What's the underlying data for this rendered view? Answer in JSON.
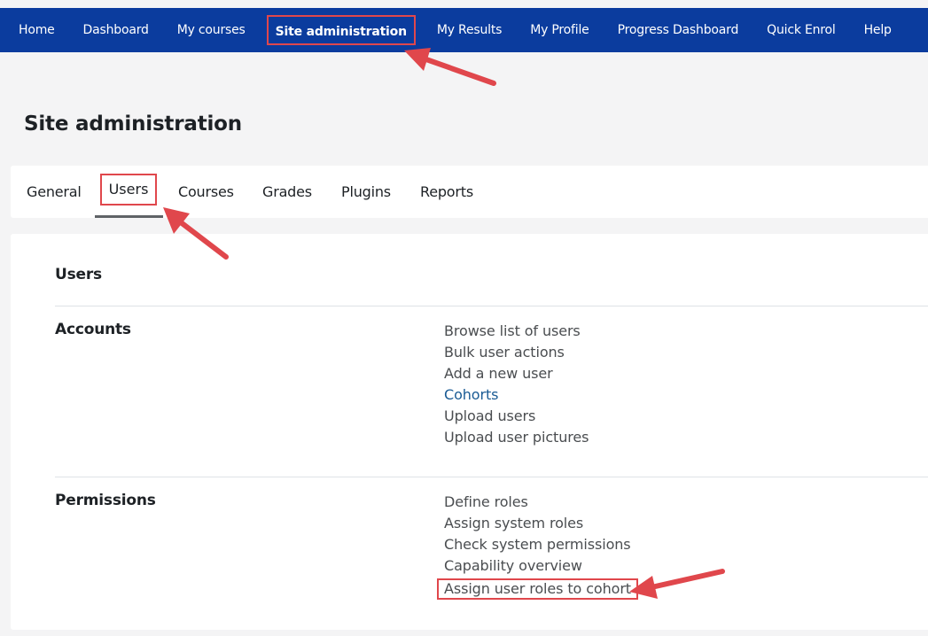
{
  "topnav": {
    "items": [
      {
        "label": "Home"
      },
      {
        "label": "Dashboard"
      },
      {
        "label": "My courses"
      },
      {
        "label": "Site administration"
      },
      {
        "label": "My Results"
      },
      {
        "label": "My Profile"
      },
      {
        "label": "Progress Dashboard"
      },
      {
        "label": "Quick Enrol"
      },
      {
        "label": "Help"
      }
    ],
    "active_index": 3
  },
  "page": {
    "title": "Site administration"
  },
  "tabs": [
    {
      "label": "General"
    },
    {
      "label": "Users"
    },
    {
      "label": "Courses"
    },
    {
      "label": "Grades"
    },
    {
      "label": "Plugins"
    },
    {
      "label": "Reports"
    }
  ],
  "users_section": {
    "heading": "Users"
  },
  "accounts": {
    "heading": "Accounts",
    "links": [
      {
        "label": "Browse list of users"
      },
      {
        "label": "Bulk user actions"
      },
      {
        "label": "Add a new user"
      },
      {
        "label": "Cohorts"
      },
      {
        "label": "Upload users"
      },
      {
        "label": "Upload user pictures"
      }
    ]
  },
  "permissions": {
    "heading": "Permissions",
    "links": [
      {
        "label": "Define roles"
      },
      {
        "label": "Assign system roles"
      },
      {
        "label": "Check system permissions"
      },
      {
        "label": "Capability overview"
      },
      {
        "label": "Assign user roles to cohort"
      }
    ]
  },
  "colors": {
    "nav_background": "#0b3c9e",
    "highlight": "#e0474c",
    "arrow": "#e0474c",
    "link": "#4a4d50",
    "link_active": "#1a5b94"
  },
  "annotations": {
    "arrows": [
      "arrow-to-site-administration",
      "arrow-to-users-tab",
      "arrow-to-assign-user-roles"
    ]
  }
}
